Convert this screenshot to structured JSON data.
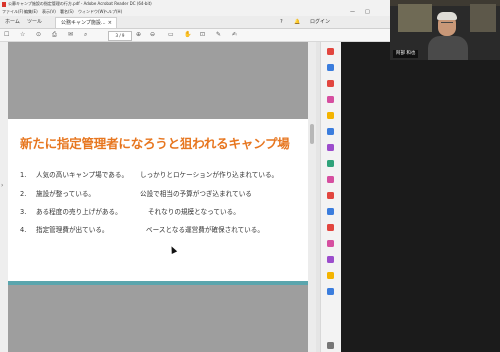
{
  "window": {
    "title": "公募キャンプ施設の指定管理の行方.pdf - Adobe Acrobat Reader DC (64-bit)",
    "minimize": "—",
    "maximize": "□"
  },
  "menu": {
    "items": [
      "ファイル(F)",
      "編集(E)",
      "表示(V)",
      "署名(S)",
      "ウィンドウ(W)",
      "ヘルプ(H)"
    ]
  },
  "tabs": {
    "home": "ホーム",
    "tools": "ツール",
    "document": "公務キャンプ施設...",
    "close": "×",
    "help": "?",
    "bell": "🔔",
    "login": "ログイン"
  },
  "toolbar": {
    "page_indicator": "3 / 9",
    "icons": [
      "☐",
      "☆",
      "⊙",
      "⎙",
      "✉",
      "⌕",
      "⊕",
      "⊖"
    ]
  },
  "slide": {
    "title": "新たに指定管理者になろうと狙われるキャンプ場",
    "items": [
      {
        "num": "1.",
        "text": "人気の高いキャンプ場である。",
        "sub": "しっかりとロケーションが作り込まれている。"
      },
      {
        "num": "2.",
        "text": "施設が整っている。",
        "sub": "公設で相当の予算がつぎ込まれている"
      },
      {
        "num": "3.",
        "text": "ある程度の売り上げがある。",
        "sub": "それなりの規模となっている。"
      },
      {
        "num": "4.",
        "text": "指定管理費が出ている。",
        "sub": "ベースとなる運営費が確保されている。"
      }
    ]
  },
  "video": {
    "participant_label": "阿部 和也"
  },
  "colors": {
    "slide_title": "#e7761f",
    "slide_accent_bar": "#5aa5ad",
    "doc_icon": "#d9342b"
  }
}
